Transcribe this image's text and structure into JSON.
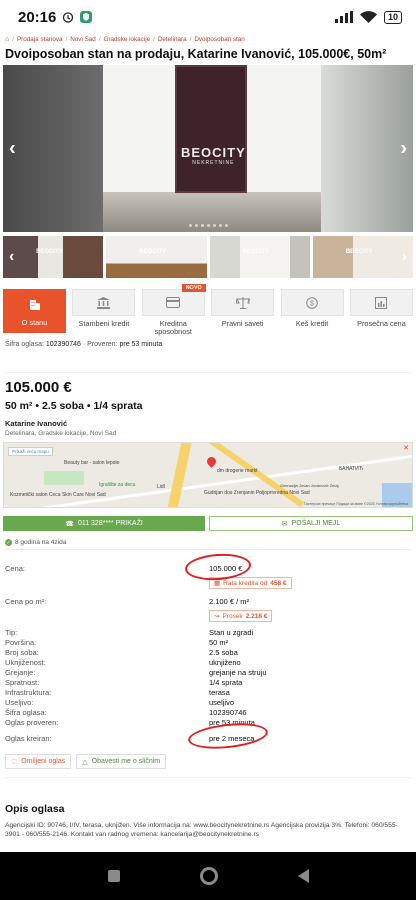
{
  "status_bar": {
    "time": "20:16",
    "battery": "10"
  },
  "breadcrumb": [
    "Prodaja stanova",
    "Novi Sad",
    "Gradske lokacije",
    "Detelinara",
    "Dvoiposoban stan"
  ],
  "title": "Dvoiposoban stan na prodaju, Katarine Ivanović, 105.000€, 50m²",
  "gallery": {
    "watermark_line1": "BEOCITY",
    "watermark_line2": "NEKRETNINE",
    "thumb_watermark": "BEOCITY"
  },
  "tabs": [
    {
      "label": "O stanu",
      "icon": "building-icon"
    },
    {
      "label": "Stambeni kredit",
      "icon": "bank-icon"
    },
    {
      "label": "Kreditna sposobnost",
      "icon": "credit-card-icon",
      "badge": "NOVO"
    },
    {
      "label": "Pravni saveti",
      "icon": "scales-icon"
    },
    {
      "label": "Keš kredit",
      "icon": "coin-icon"
    },
    {
      "label": "Prosečna cena",
      "icon": "bar-chart-icon"
    }
  ],
  "sifra": {
    "label": "Šifra oglasa:",
    "value": "102390746",
    "verified_label": "Proveren:",
    "verified_value": "pre 53 minuta"
  },
  "listing": {
    "price": "105.000 €",
    "specs": "50 m² • 2.5 soba • 1/4 sprata",
    "owner": "Katarine Ivanović",
    "location": "Detelinara, Gradske lokacije, Novi Sad"
  },
  "map": {
    "bigger_map": "Prikaži veću mapu",
    "labels": [
      "Beauty bar - salon lepote",
      "Igralište za decu",
      "Kozmetički salon Ceca Skin Care Novi Sad",
      "dm drogerie markt",
      "Lidl",
      "Gimnazija Jovan Jovanović Zmaj",
      "Gudrijan dos Zrenjanin Poljoprivredna Novi Sad",
      "БАНАТИЋ"
    ],
    "footer": "Тастерске пречице   Подаци за мапе ©2023   Услови коришћења"
  },
  "actions": {
    "call": "011 328**** PRIKAŽI",
    "mail": "POŠALJI MEJL"
  },
  "active_since": "8 godina na 4zida",
  "details": [
    {
      "k": "Tip:",
      "v": "Stan u zgradi"
    },
    {
      "k": "Površina:",
      "v": "50 m²"
    },
    {
      "k": "Broj soba:",
      "v": "2.5 soba"
    },
    {
      "k": "Uknjiženost:",
      "v": "uknjiženo"
    },
    {
      "k": "Grejanje:",
      "v": "grejanje na struju"
    },
    {
      "k": "Spratnost:",
      "v": "1/4 sprata"
    },
    {
      "k": "Infrastruktura:",
      "v": "terasa"
    },
    {
      "k": "Useljivo:",
      "v": "useljivo"
    },
    {
      "k": "Šifra oglasa:",
      "v": "102390746"
    },
    {
      "k": "Oglas proveren:",
      "v": "pre 53 minuta"
    },
    {
      "k": "Oglas kreiran:",
      "v": "pre 2 meseca"
    }
  ],
  "price_block": {
    "cena_label": "Cena:",
    "cena_value": "105.000 €",
    "rata_label": "Rata kredita od",
    "rata_value": "458 €",
    "per_m2_label": "Cena po m²:",
    "per_m2_value": "2.100 € / m²",
    "prosek_label": "Prosek",
    "prosek_value": "2.218 €"
  },
  "fav": {
    "save": "Omiljeni oglas",
    "notify": "Obavesti me o sličnim"
  },
  "description": {
    "title": "Opis oglasa",
    "text": "Agencijski ID: 90746, I/IV, terasa, uknjižen. Više informacija na: www.beocitynekretnine.rs Agencijska provizija 3%. Telefoni: 060/555-3901 - 060/555-2146. Kontakt van radnog vremena: kancelarija@beocitynekretnine.rs"
  },
  "colors": {
    "accent": "#e8532c",
    "green": "#6aa84f",
    "annotation": "#e02020"
  }
}
